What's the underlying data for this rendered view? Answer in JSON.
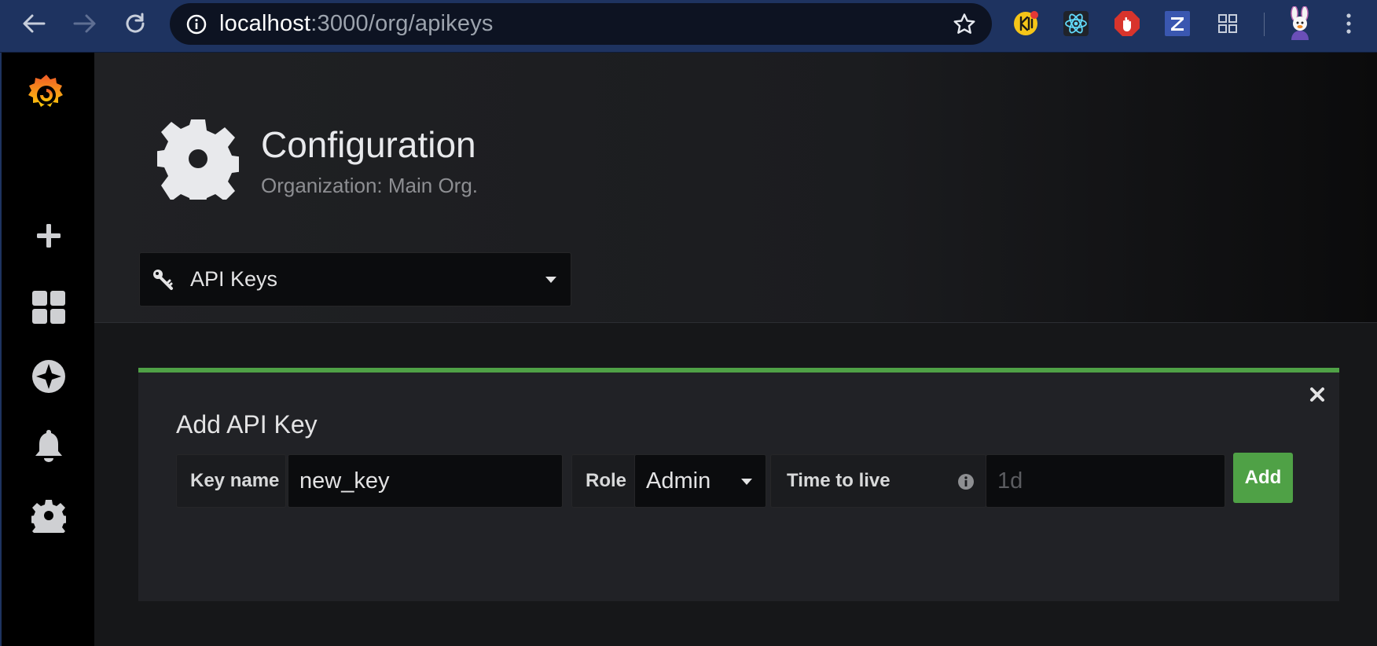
{
  "browser": {
    "url_host": "localhost",
    "url_path": ":3000/org/apikeys",
    "icons": [
      "back-arrow-icon",
      "forward-arrow-icon",
      "reload-icon",
      "info-icon",
      "star-icon",
      "keeper-extension-icon",
      "react-devtools-icon",
      "adblock-icon",
      "zotero-icon",
      "extensions-grid-icon",
      "profile-avatar-icon",
      "more-menu-icon"
    ]
  },
  "sidebar": {
    "icons": [
      "grafana-logo-icon",
      "plus-icon",
      "dashboards-icon",
      "explore-compass-icon",
      "bell-icon",
      "gear-icon"
    ]
  },
  "header": {
    "title": "Configuration",
    "subtitle": "Organization: Main Org."
  },
  "nav_select": {
    "label": "API Keys"
  },
  "add_api_key": {
    "title": "Add API Key",
    "key_name_label": "Key name",
    "key_name_value": "new_key",
    "role_label": "Role",
    "role_value": "Admin",
    "ttl_label": "Time to live",
    "ttl_placeholder": "1d",
    "add_button": "Add"
  },
  "colors": {
    "browser_frame": "#1e3360",
    "accent_green": "#4fa146",
    "background": "#161719",
    "panel": "#212226"
  }
}
